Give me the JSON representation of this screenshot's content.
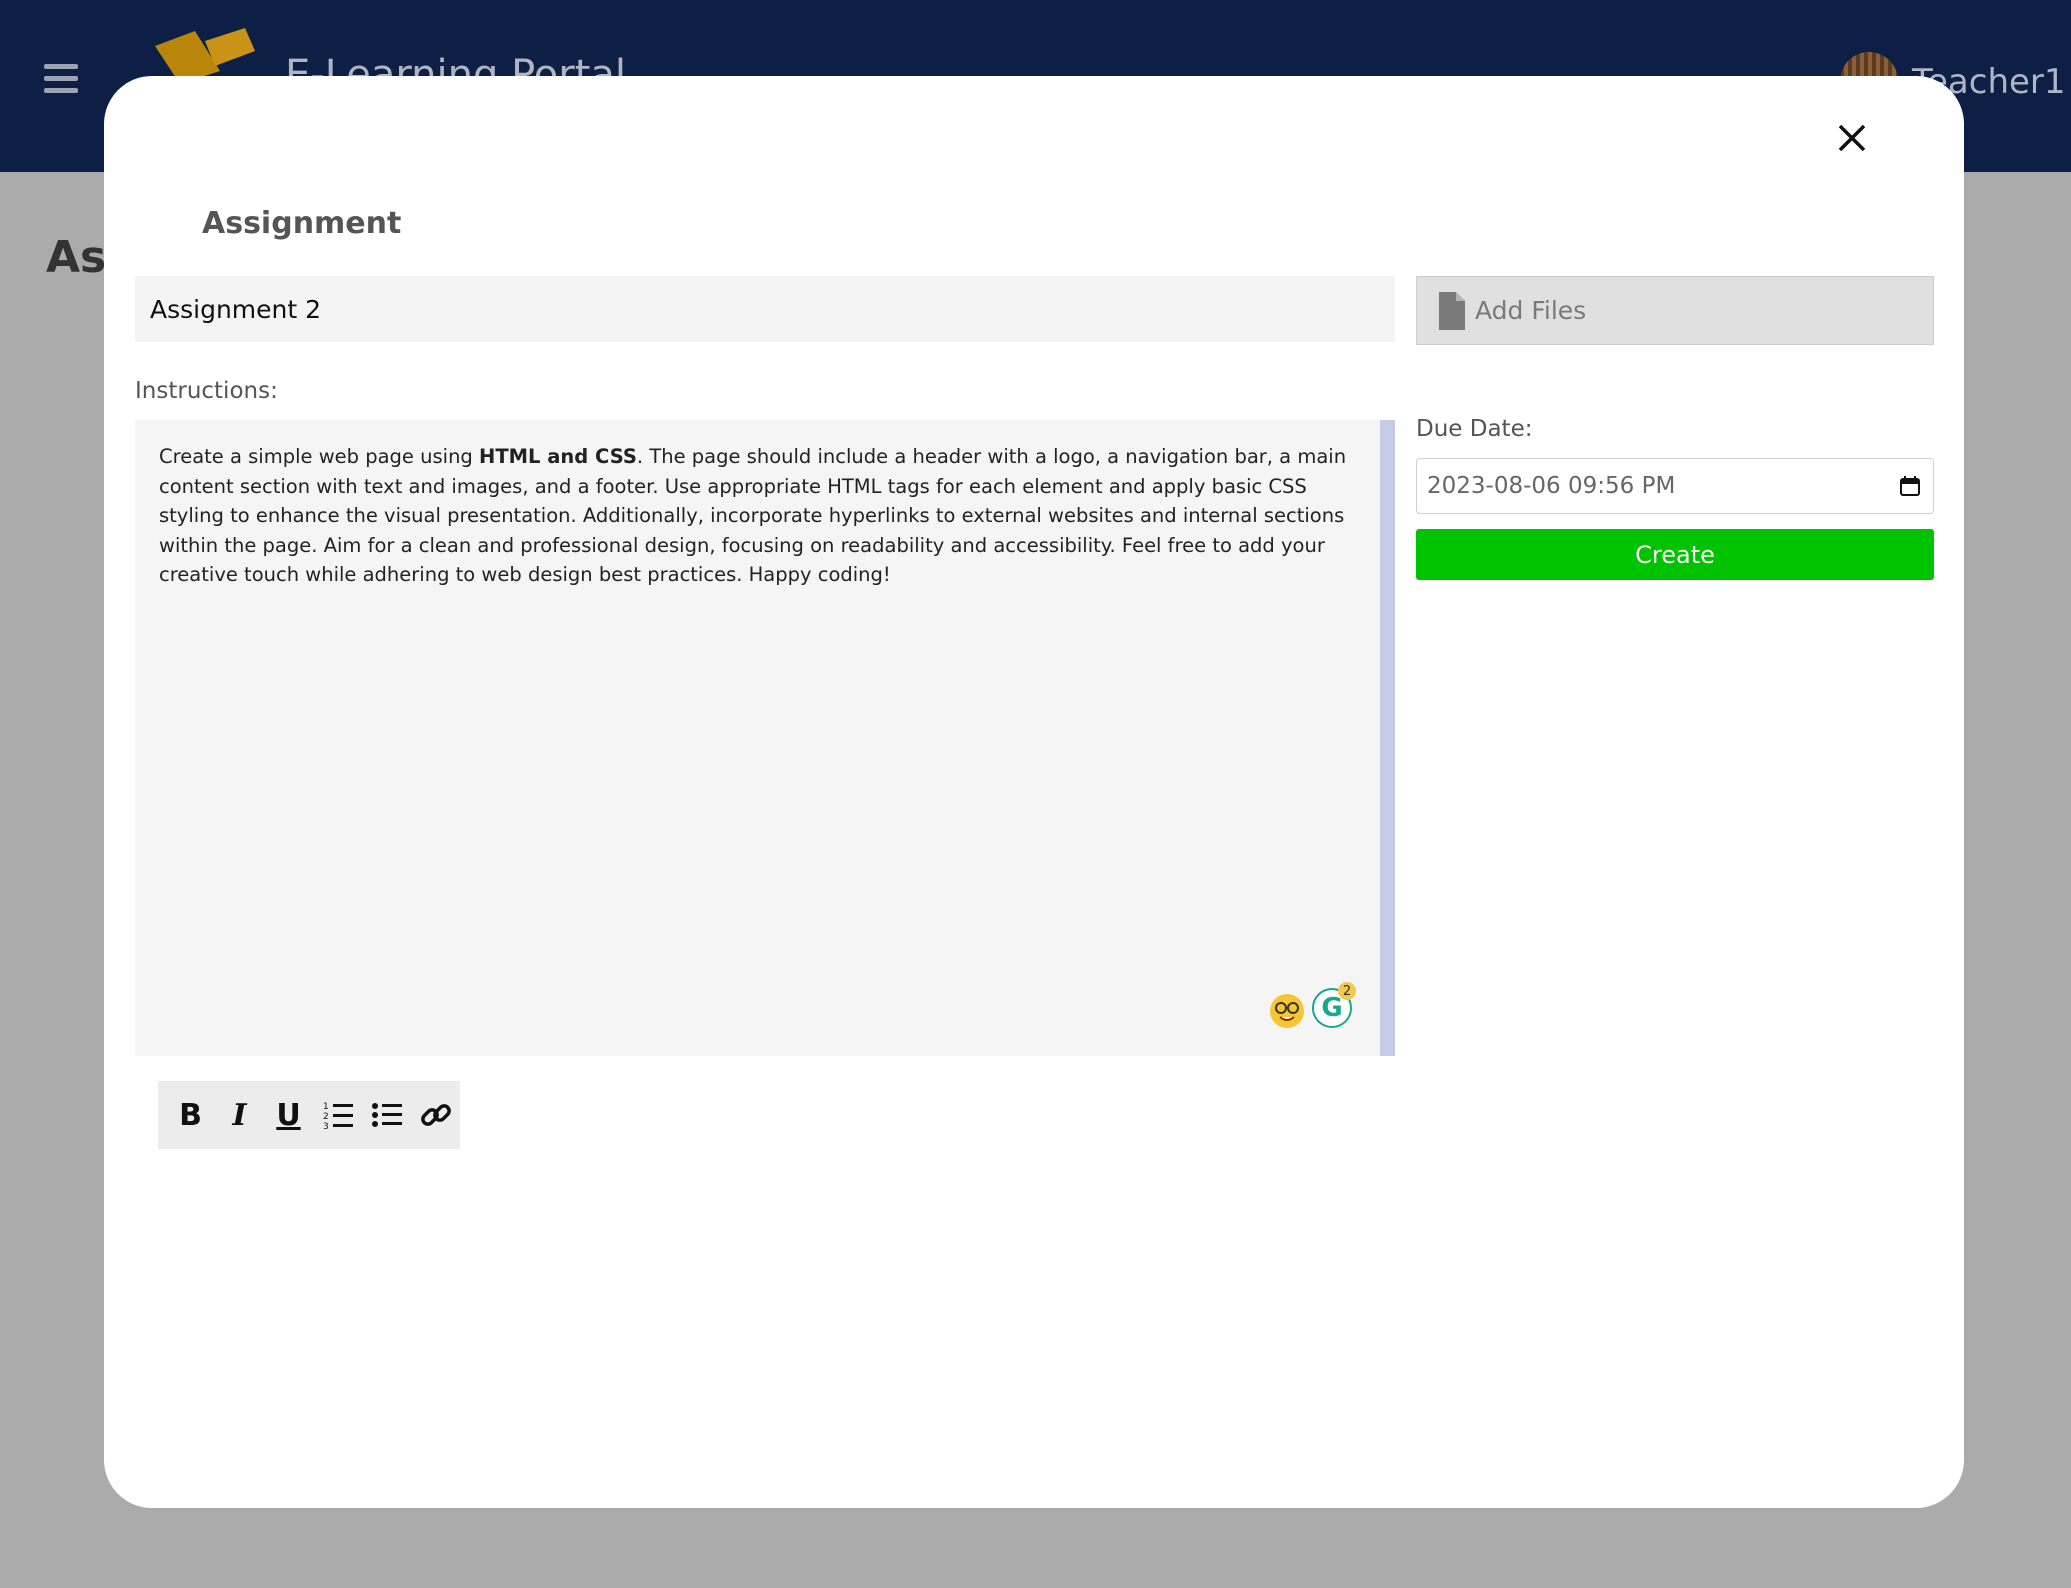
{
  "app": {
    "title": "E-Learning Portal",
    "username": "Teacher1",
    "background_heading": "Ass"
  },
  "modal": {
    "title": "Assignment",
    "assignment_title_value": "Assignment 2",
    "add_files_label": "Add Files",
    "instructions_label": "Instructions:",
    "instructions": {
      "part1": "Create a simple web page using ",
      "bold": "HTML and CSS",
      "part2": ". The page should include a header with a logo, a navigation bar, a main content section with text and images, and a footer. Use appropriate HTML tags for each element and apply basic CSS styling to enhance the visual presentation. Additionally, incorporate hyperlinks to external websites and internal sections within the page. Aim for a clean and professional design, focusing on readability and accessibility. Feel free to add your creative touch while adhering to web design best practices. Happy coding!"
    },
    "due_date_label": "Due Date:",
    "due_date_value": "2023-08-06 09:56 PM",
    "create_button": "Create",
    "grammarly_badge": "2",
    "grammarly_letter": "G"
  },
  "toolbar": {
    "bold": "B",
    "italic": "I",
    "underline": "U"
  },
  "colors": {
    "topbar": "#0d1f44",
    "create_button": "#00c300",
    "backdrop": "#ababab",
    "logo": "#b8860b"
  },
  "icons": [
    "hamburger-icon",
    "pencil-ruler-logo-icon",
    "avatar",
    "close-icon",
    "file-icon",
    "calendar-icon",
    "nerd-emoji-icon",
    "grammarly-icon",
    "bold-icon",
    "italic-icon",
    "underline-icon",
    "ordered-list-icon",
    "unordered-list-icon",
    "link-icon"
  ]
}
